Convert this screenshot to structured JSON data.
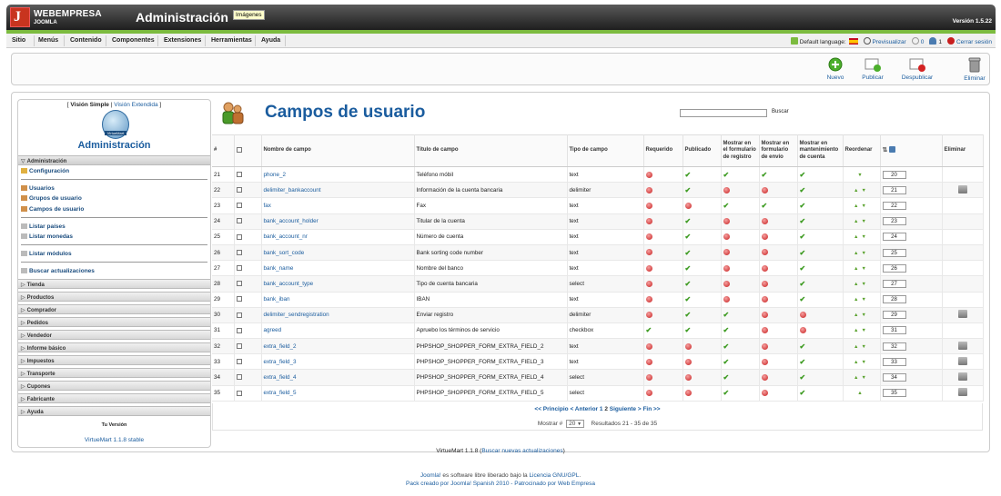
{
  "header": {
    "brand_line1": "WEBEMPRESA",
    "brand_line2": "JOOMLA",
    "title": "Administración",
    "tooltip": "Imágenes",
    "version": "Versión 1.5.22"
  },
  "menu": {
    "items": [
      "Sitio",
      "Menús",
      "Contenido",
      "Componentes",
      "Extensiones",
      "Herramientas",
      "Ayuda"
    ],
    "default_language": "Default language:",
    "preview": "Previsualizar",
    "messages_count": "0",
    "users_count": "1",
    "logout": "Cerrar sesión"
  },
  "toolbar": {
    "new": "Nuevo",
    "publish": "Publicar",
    "unpublish": "Despublicar",
    "delete": "Eliminar"
  },
  "sidebar": {
    "simple_view": "Visión Simple",
    "extended_view": "Visión Extendida",
    "logo_text": "VirtueMart",
    "title": "Administración",
    "admin_section": "Administración",
    "configuration": "Configuración",
    "users": "Usuarios",
    "user_groups": "Grupos de usuario",
    "user_fields": "Campos de usuario",
    "list_countries": "Listar países",
    "list_currencies": "Listar monedas",
    "list_modules": "Listar módulos",
    "search_updates": "Buscar actualizaciones",
    "sections": [
      "Tienda",
      "Productos",
      "Comprador",
      "Pedidos",
      "Vendedor",
      "Informe básico",
      "Impuestos",
      "Transporte",
      "Cupones",
      "Fabricante",
      "Ayuda"
    ],
    "version_title": "Tu Versión",
    "version_value": "VirtueMart 1.1.8 stable"
  },
  "content": {
    "title": "Campos de usuario",
    "search_button": "Buscar",
    "columns": {
      "num": "#",
      "name": "Nombre de campo",
      "label": "Título de campo",
      "type": "Tipo de campo",
      "required": "Requerido",
      "published": "Publicado",
      "show_register": "Mostrar en el formulario de registro",
      "show_shipping": "Mostrar en formulario de envío",
      "show_account": "Mostrar en mantenimiento de cuenta",
      "reorder": "Reordenar",
      "delete": "Eliminar"
    },
    "rows": [
      {
        "num": "21",
        "name": "phone_2",
        "label": "Teléfono móbil",
        "type": "text",
        "req": false,
        "pub": true,
        "reg": true,
        "ship": true,
        "acc": true,
        "up": false,
        "down": true,
        "order": "20",
        "del": false
      },
      {
        "num": "22",
        "name": "delimiter_bankaccount",
        "label": "Información de la cuenta bancaria",
        "type": "delimiter",
        "req": false,
        "pub": true,
        "reg": false,
        "ship": false,
        "acc": true,
        "up": true,
        "down": true,
        "order": "21",
        "del": true
      },
      {
        "num": "23",
        "name": "fax",
        "label": "Fax",
        "type": "text",
        "req": false,
        "pub": false,
        "reg": true,
        "ship": true,
        "acc": true,
        "up": true,
        "down": true,
        "order": "22",
        "del": false
      },
      {
        "num": "24",
        "name": "bank_account_holder",
        "label": "Titular de la cuenta",
        "type": "text",
        "req": false,
        "pub": true,
        "reg": false,
        "ship": false,
        "acc": true,
        "up": true,
        "down": true,
        "order": "23",
        "del": false
      },
      {
        "num": "25",
        "name": "bank_account_nr",
        "label": "Número de cuenta",
        "type": "text",
        "req": false,
        "pub": true,
        "reg": false,
        "ship": false,
        "acc": true,
        "up": true,
        "down": true,
        "order": "24",
        "del": false
      },
      {
        "num": "26",
        "name": "bank_sort_code",
        "label": "Bank sorting code number",
        "type": "text",
        "req": false,
        "pub": true,
        "reg": false,
        "ship": false,
        "acc": true,
        "up": true,
        "down": true,
        "order": "25",
        "del": false
      },
      {
        "num": "27",
        "name": "bank_name",
        "label": "Nombre del banco",
        "type": "text",
        "req": false,
        "pub": true,
        "reg": false,
        "ship": false,
        "acc": true,
        "up": true,
        "down": true,
        "order": "26",
        "del": false
      },
      {
        "num": "28",
        "name": "bank_account_type",
        "label": "Tipo de cuenta bancaria",
        "type": "select",
        "req": false,
        "pub": true,
        "reg": false,
        "ship": false,
        "acc": true,
        "up": true,
        "down": true,
        "order": "27",
        "del": false
      },
      {
        "num": "29",
        "name": "bank_iban",
        "label": "IBAN",
        "type": "text",
        "req": false,
        "pub": true,
        "reg": false,
        "ship": false,
        "acc": true,
        "up": true,
        "down": true,
        "order": "28",
        "del": false
      },
      {
        "num": "30",
        "name": "delimiter_sendregistration",
        "label": "Enviar registro",
        "type": "delimiter",
        "req": false,
        "pub": true,
        "reg": true,
        "ship": false,
        "acc": false,
        "up": true,
        "down": true,
        "order": "29",
        "del": true
      },
      {
        "num": "31",
        "name": "agreed",
        "label": "Apruebo los términos de servicio",
        "type": "checkbox",
        "req": true,
        "pub": true,
        "reg": true,
        "ship": false,
        "acc": false,
        "up": true,
        "down": true,
        "order": "31",
        "del": false
      },
      {
        "num": "32",
        "name": "extra_field_2",
        "label": "PHPSHOP_SHOPPER_FORM_EXTRA_FIELD_2",
        "type": "text",
        "req": false,
        "pub": false,
        "reg": true,
        "ship": false,
        "acc": true,
        "up": true,
        "down": true,
        "order": "32",
        "del": true
      },
      {
        "num": "33",
        "name": "extra_field_3",
        "label": "PHPSHOP_SHOPPER_FORM_EXTRA_FIELD_3",
        "type": "text",
        "req": false,
        "pub": false,
        "reg": true,
        "ship": false,
        "acc": true,
        "up": true,
        "down": true,
        "order": "33",
        "del": true
      },
      {
        "num": "34",
        "name": "extra_field_4",
        "label": "PHPSHOP_SHOPPER_FORM_EXTRA_FIELD_4",
        "type": "select",
        "req": false,
        "pub": false,
        "reg": true,
        "ship": false,
        "acc": true,
        "up": true,
        "down": true,
        "order": "34",
        "del": true
      },
      {
        "num": "35",
        "name": "extra_field_5",
        "label": "PHPSHOP_SHOPPER_FORM_EXTRA_FIELD_5",
        "type": "select",
        "req": false,
        "pub": false,
        "reg": true,
        "ship": false,
        "acc": true,
        "up": true,
        "down": false,
        "order": "35",
        "del": true
      }
    ],
    "pagination": {
      "first": "<< Principio",
      "prev": "< Anterior",
      "page1": "1",
      "page2": "2",
      "next": "Siguiente >",
      "last": "Fin >>",
      "show_label": "Mostrar #",
      "limit": "20",
      "results": "Resultados 21 - 35 de 35"
    }
  },
  "footer": {
    "vm_version": "VirtueMart 1.1.8",
    "vm_updates": "Buscar nuevas actualizaciones",
    "joomla_link": "Joomla!",
    "free_text": "es software libre liberado bajo la",
    "license": "Licencia GNU/GPL",
    "pack_text": "Pack creado por Joomla! Spanish 2010 - Patrocinado por Web Empresa"
  }
}
